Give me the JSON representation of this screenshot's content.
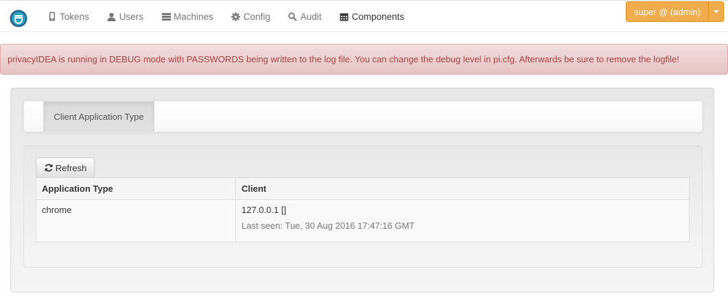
{
  "nav": {
    "items": [
      {
        "label": "Tokens",
        "icon": "phone-icon"
      },
      {
        "label": "Users",
        "icon": "user-icon"
      },
      {
        "label": "Machines",
        "icon": "server-icon"
      },
      {
        "label": "Config",
        "icon": "gear-icon"
      },
      {
        "label": "Audit",
        "icon": "search-icon"
      },
      {
        "label": "Components",
        "icon": "calendar-icon"
      }
    ],
    "active": "Components",
    "user_label": "super @ (admin)"
  },
  "alert": {
    "text": "privacyIDEA is running in DEBUG mode with PASSWORDS being written to the log file. You can change the debug level in pi.cfg. Afterwards be sure to remove the logfile!"
  },
  "tabs": [
    {
      "label": "Client Application Type"
    }
  ],
  "refresh_label": "Refresh",
  "table": {
    "headers": [
      "Application Type",
      "Client"
    ],
    "rows": [
      {
        "application_type": "chrome",
        "client": "127.0.0.1 []",
        "last_seen": "Last seen: Tue, 30 Aug 2016 17:47:16 GMT"
      }
    ]
  },
  "colors": {
    "accent": "#f0ad4e",
    "alert_text": "#a94442",
    "alert_bg": "#f2dede",
    "logo_blue": "#2f6f9f"
  }
}
